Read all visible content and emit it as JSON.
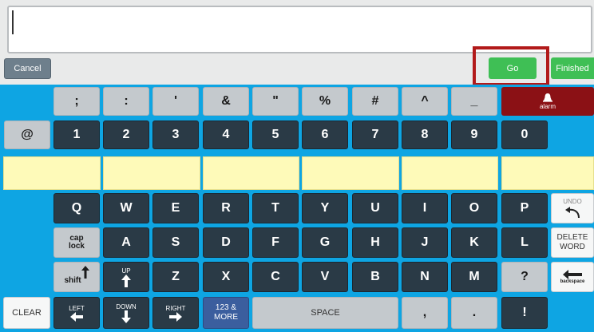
{
  "toolbar": {
    "cancel": "Cancel",
    "go": "Go",
    "finished": "Finished"
  },
  "alarm": {
    "label": "alarm"
  },
  "symbols": [
    ";",
    ":",
    "'",
    "&",
    "\"",
    "%",
    "#",
    "^",
    "_"
  ],
  "numbers": {
    "at": "@",
    "digits": [
      "1",
      "2",
      "3",
      "4",
      "5",
      "6",
      "7",
      "8",
      "9",
      "0"
    ]
  },
  "row_q": [
    "Q",
    "W",
    "E",
    "R",
    "T",
    "Y",
    "U",
    "I",
    "O",
    "P"
  ],
  "row_a": [
    "A",
    "S",
    "D",
    "F",
    "G",
    "H",
    "J",
    "K",
    "L"
  ],
  "row_z": [
    "Z",
    "X",
    "C",
    "V",
    "B",
    "N",
    "M",
    "?"
  ],
  "special": {
    "undo": "UNDO",
    "delete_word": [
      "DELETE",
      "WORD"
    ],
    "cap_lock": [
      "cap",
      "lock"
    ],
    "shift": "shift",
    "up": "UP",
    "backspace": "backspace",
    "clear": "CLEAR",
    "left": "LEFT",
    "down": "DOWN",
    "right": "RIGHT",
    "more": [
      "123 &",
      "MORE"
    ],
    "space": "SPACE",
    "comma": ",",
    "period": ".",
    "exclaim": "!"
  },
  "colors": {
    "keyboard_bg": "#0ea5e3",
    "dark_key": "#2a3a46",
    "green": "#3fbf55",
    "highlight": "#b21a1a",
    "alarm": "#8b1115",
    "prediction": "#fefab9"
  }
}
